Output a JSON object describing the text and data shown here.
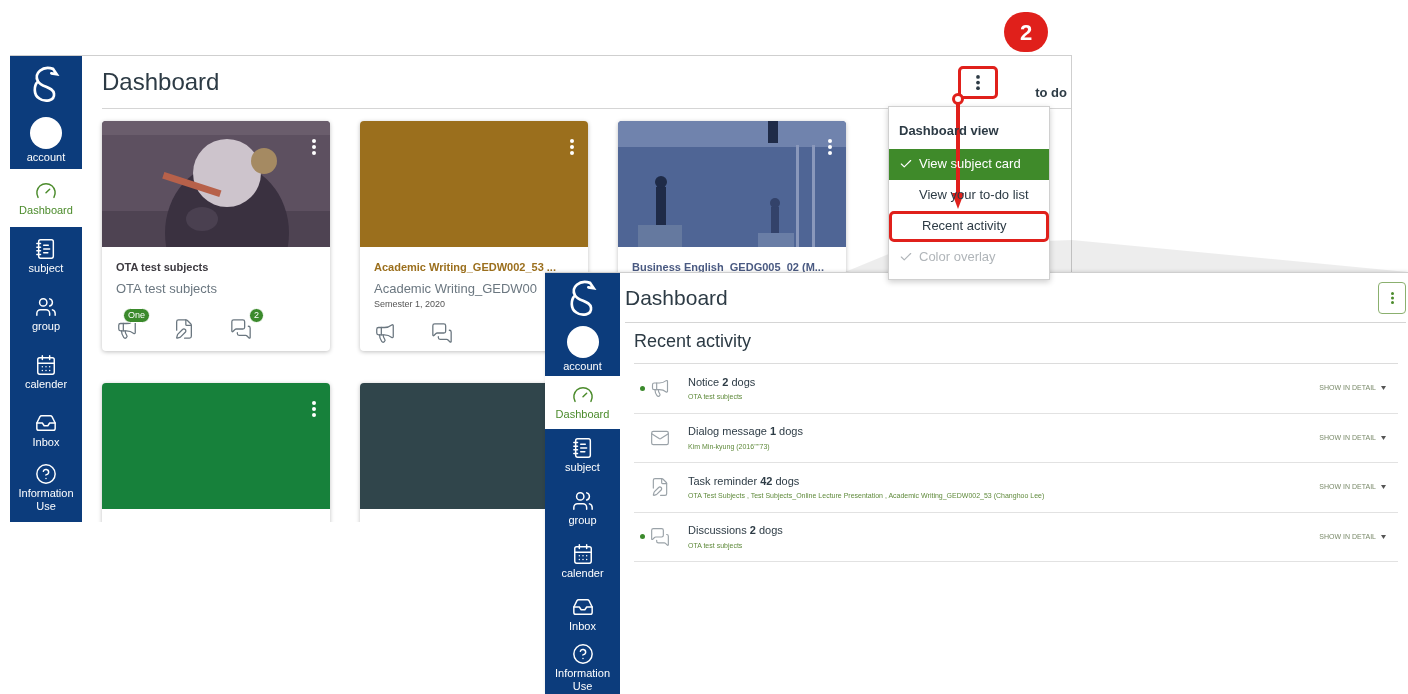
{
  "step_badge": "2",
  "back_screen": {
    "title": "Dashboard",
    "todo_label": "to do",
    "more_button": {
      "highlighted": true
    },
    "sidebar": [
      {
        "label": "account",
        "kind": "avatar",
        "selected": false
      },
      {
        "label": "Dashboard",
        "kind": "dashboard",
        "selected": true
      },
      {
        "label": "subject",
        "kind": "subject",
        "selected": false
      },
      {
        "label": "group",
        "kind": "group",
        "selected": false
      },
      {
        "label": "calender",
        "kind": "calendar",
        "selected": false
      },
      {
        "label": "Inbox",
        "kind": "inbox",
        "selected": false
      },
      {
        "label": "Information Use",
        "kind": "help",
        "selected": false
      }
    ],
    "menu": {
      "header": "Dashboard view",
      "items": [
        {
          "label": "View subject card",
          "checked": true,
          "selected": true,
          "disabled": false,
          "highlighted": false
        },
        {
          "label": "View your to-do list",
          "checked": false,
          "selected": false,
          "disabled": false,
          "highlighted": false
        },
        {
          "label": "Recent activity",
          "checked": false,
          "selected": false,
          "disabled": false,
          "highlighted": true
        },
        {
          "label": "Color overlay",
          "checked": true,
          "selected": false,
          "disabled": true,
          "highlighted": false
        }
      ]
    },
    "cards": [
      {
        "kind": "picture",
        "color": "#3d3a40",
        "kebab": true,
        "title": "OTA test subjects",
        "subtitle": "OTA test subjects",
        "icons": [
          {
            "kind": "notice",
            "badge": "One"
          },
          {
            "kind": "task"
          },
          {
            "kind": "discussion",
            "badge": "2"
          }
        ]
      },
      {
        "kind": "color",
        "color": "#9b6f1d",
        "kebab": true,
        "title": "Academic Writing_GEDW002_53 ...",
        "subtitle": "Academic Writing_GEDW00",
        "term": "Semester 1, 2020",
        "icons": [
          {
            "kind": "notice"
          },
          {
            "kind": "discussion"
          }
        ]
      },
      {
        "kind": "picture",
        "color": "#4a5a82",
        "kebab": true,
        "title": "Business English_GEDG005_02 (M..."
      },
      {
        "kind": "color",
        "color": "#17813b",
        "kebab": true
      },
      {
        "kind": "color",
        "color": "#30454b"
      }
    ]
  },
  "front_screen": {
    "title": "Dashboard",
    "more_button": {
      "highlighted": false
    },
    "sidebar": [
      {
        "label": "account",
        "kind": "avatar",
        "selected": false
      },
      {
        "label": "Dashboard",
        "kind": "dashboard",
        "selected": true
      },
      {
        "label": "subject",
        "kind": "subject",
        "selected": false
      },
      {
        "label": "group",
        "kind": "group",
        "selected": false
      },
      {
        "label": "calender",
        "kind": "calendar",
        "selected": false
      },
      {
        "label": "Inbox",
        "kind": "inbox",
        "selected": false
      },
      {
        "label": "Information Use",
        "kind": "help",
        "selected": false
      }
    ],
    "heading": "Recent activity",
    "rows": [
      {
        "kind": "notice",
        "unread": true,
        "title": "Notice **2** dogs",
        "detail": "OTA test subjects",
        "action": "SHOW IN DETAIL"
      },
      {
        "kind": "message",
        "unread": false,
        "title": "Dialog message **1** dogs",
        "detail": "Kim Min-kyung (2016''''73)",
        "action": "SHOW IN DETAIL"
      },
      {
        "kind": "task",
        "unread": false,
        "title": "Task reminder **42** dogs",
        "detail": "OTA Test Subjects , Test Subjects_Online Lecture Presentation , Academic Writing_GEDW002_53 (Changhoo Lee)",
        "action": "SHOW IN DETAIL"
      },
      {
        "kind": "discussion",
        "unread": true,
        "title": "Discussions **2** dogs",
        "detail": "OTA test subjects",
        "action": "SHOW IN DETAIL"
      }
    ]
  }
}
